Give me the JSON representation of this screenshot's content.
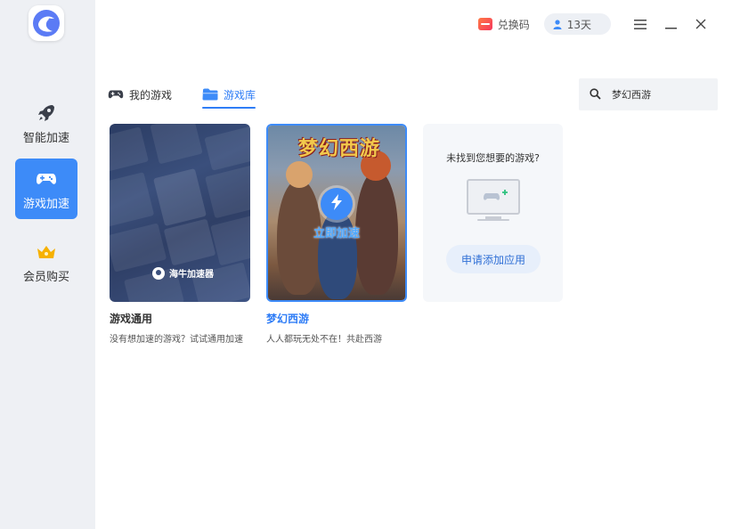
{
  "sidebar": {
    "logo_icon": "dolphin-logo-icon",
    "items": [
      {
        "label": "智能加速",
        "icon": "rocket-icon",
        "active": false
      },
      {
        "label": "游戏加速",
        "icon": "gamepad-icon",
        "active": true
      },
      {
        "label": "会员购买",
        "icon": "crown-icon",
        "active": false
      }
    ],
    "active_color": "#3d8bf8"
  },
  "topbar": {
    "redeem_label": "兑换码",
    "days_label": "13天",
    "menu_icon": "menu-icon",
    "minimize_icon": "minimize-icon",
    "close_icon": "close-icon"
  },
  "tabs": [
    {
      "label": "我的游戏",
      "icon": "gamepad-icon",
      "active": false
    },
    {
      "label": "游戏库",
      "icon": "folder-icon",
      "active": true
    }
  ],
  "search": {
    "value": "梦幻西游",
    "icon": "search-icon"
  },
  "cards": [
    {
      "title": "游戏通用",
      "description": "没有想加速的游戏？试试通用加速",
      "badge": "海牛加速器"
    },
    {
      "title": "梦幻西游",
      "description": "人人都玩无处不在！共赴西游",
      "art_logo": "梦幻西游",
      "action_label": "立即加速",
      "action_icon": "lightning-icon"
    }
  ],
  "not_found": {
    "title": "未找到您想要的游戏?",
    "button_label": "申请添加应用",
    "icon": "monitor-add-icon"
  }
}
